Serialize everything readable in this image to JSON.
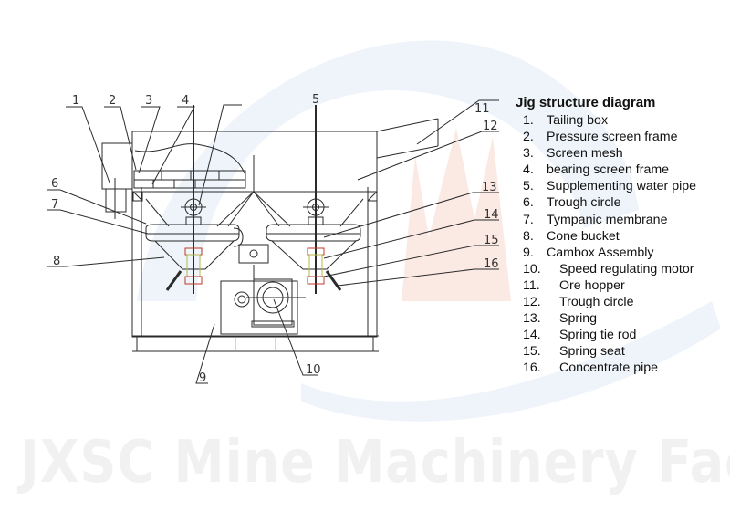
{
  "diagram": {
    "title": "Jig structure diagram",
    "watermark": "JXSC Mine Machinery Factory",
    "colors": {
      "line": "#2a2a2a",
      "accent_spring": "#c0392b",
      "accent_rod": "#b5b84a",
      "background_arc": "#eef4fa",
      "background_flame": "#fbe9e4",
      "cyan_marks": "#7cc6cf"
    },
    "parts": [
      {
        "num": "1.",
        "label": "Tailing box"
      },
      {
        "num": "2.",
        "label": "Pressure screen frame"
      },
      {
        "num": "3.",
        "label": "Screen mesh"
      },
      {
        "num": "4.",
        "label": "bearing screen frame"
      },
      {
        "num": "5.",
        "label": "Supplementing water pipe"
      },
      {
        "num": "6.",
        "label": "Trough circle"
      },
      {
        "num": "7.",
        "label": "Tympanic membrane"
      },
      {
        "num": "8.",
        "label": "Cone bucket"
      },
      {
        "num": "9.",
        "label": "Cambox Assembly"
      },
      {
        "num": "10.",
        "label": "Speed regulating motor"
      },
      {
        "num": "11.",
        "label": "Ore hopper"
      },
      {
        "num": "12.",
        "label": "Trough circle"
      },
      {
        "num": "13.",
        "label": "Spring"
      },
      {
        "num": "14.",
        "label": "Spring tie rod"
      },
      {
        "num": "15.",
        "label": "Spring seat"
      },
      {
        "num": "16.",
        "label": "Concentrate pipe"
      }
    ],
    "callouts": [
      "1",
      "2",
      "3",
      "4",
      "5",
      "6",
      "7",
      "8",
      "9",
      "10",
      "11",
      "12",
      "13",
      "14",
      "15",
      "16"
    ]
  }
}
